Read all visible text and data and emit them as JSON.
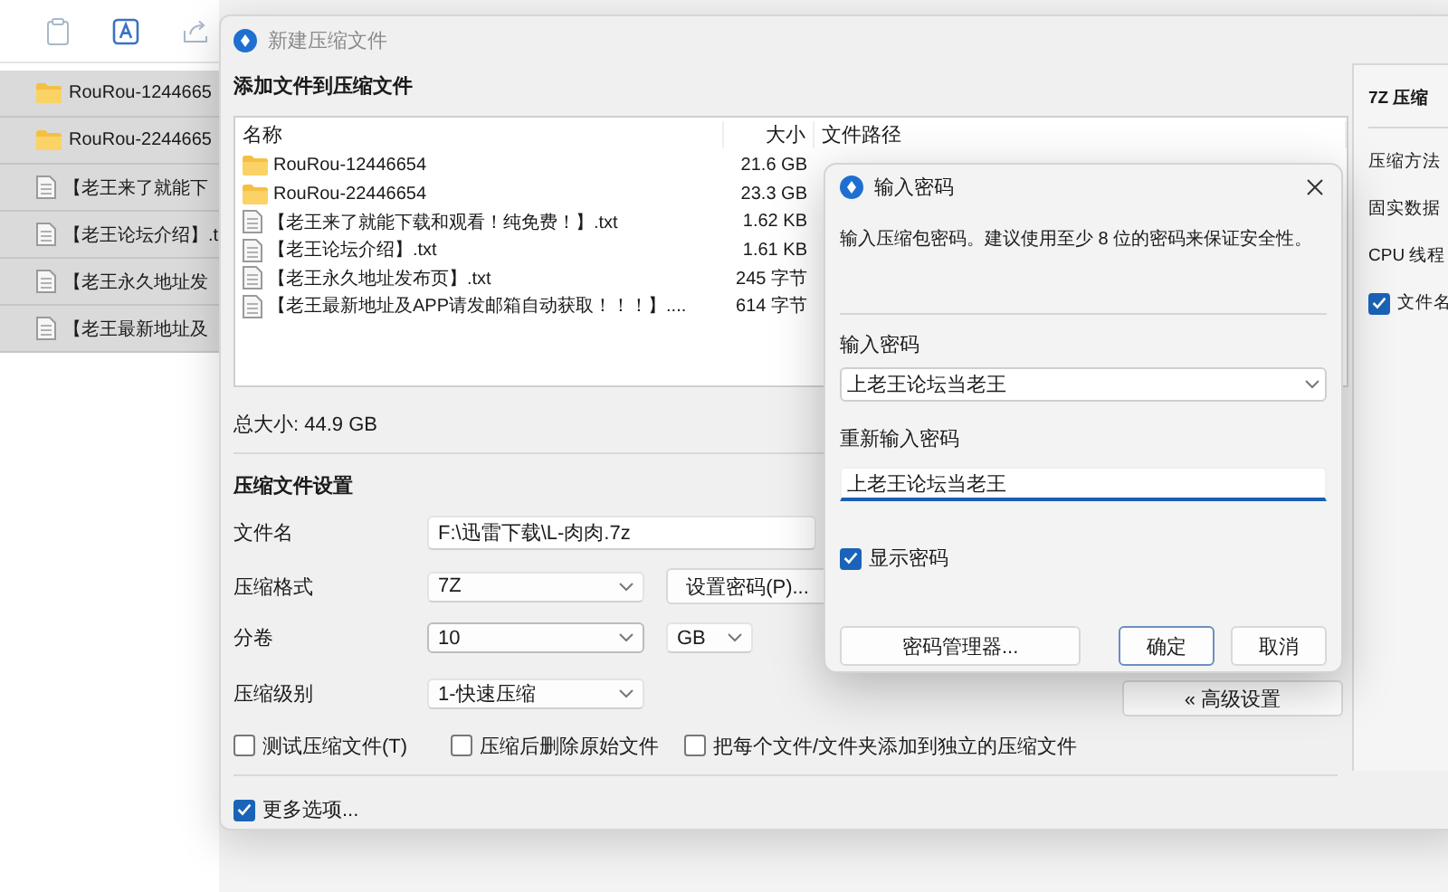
{
  "explorer": {
    "rows": [
      {
        "kind": "folder",
        "name": "RouRou-1244665"
      },
      {
        "kind": "folder",
        "name": "RouRou-2244665"
      },
      {
        "kind": "file",
        "name": "【老王来了就能下"
      },
      {
        "kind": "file",
        "name": "【老王论坛介绍】.t"
      },
      {
        "kind": "file",
        "name": "【老王永久地址发"
      },
      {
        "kind": "file",
        "name": "【老王最新地址及"
      }
    ]
  },
  "archive_dialog": {
    "title": "新建压缩文件",
    "heading": "添加文件到压缩文件",
    "table": {
      "columns": [
        "名称",
        "大小",
        "文件路径"
      ],
      "rows": [
        {
          "kind": "folder",
          "name": "RouRou-12446654",
          "size": "21.6 GB"
        },
        {
          "kind": "folder",
          "name": "RouRou-22446654",
          "size": "23.3 GB"
        },
        {
          "kind": "file",
          "name": "【老王来了就能下载和观看！纯免费！】.txt",
          "size": "1.62 KB"
        },
        {
          "kind": "file",
          "name": "【老王论坛介绍】.txt",
          "size": "1.61 KB"
        },
        {
          "kind": "file",
          "name": "【老王永久地址发布页】.txt",
          "size": "245 字节"
        },
        {
          "kind": "file",
          "name": "【老王最新地址及APP请发邮箱自动获取！！！】....",
          "size": "614 字节"
        }
      ]
    },
    "total": "总大小: 44.9 GB",
    "settings_heading": "压缩文件设置",
    "filename": {
      "label": "文件名",
      "value": "F:\\迅雷下载\\L-肉肉.7z"
    },
    "format": {
      "label": "压缩格式",
      "value": "7Z"
    },
    "set_password_button": "设置密码(P)...",
    "split": {
      "label": "分卷",
      "value": "10",
      "unit": "GB"
    },
    "level": {
      "label": "压缩级别",
      "value": "1-快速压缩"
    },
    "advanced_button": "« 高级设置",
    "options": [
      {
        "label": "测试压缩文件(T)",
        "checked": false
      },
      {
        "label": "压缩后删除原始文件",
        "checked": false
      },
      {
        "label": "把每个文件/文件夹添加到独立的压缩文件",
        "checked": false
      }
    ],
    "more_options": {
      "label": "更多选项...",
      "checked": true
    },
    "side_panel": {
      "title": "7Z 压缩",
      "items": [
        "压缩方法",
        "固实数据",
        "CPU 线程"
      ],
      "checkbox": {
        "label": "文件名",
        "checked": true
      }
    }
  },
  "password_dialog": {
    "title": "输入密码",
    "message": "输入压缩包密码。建议使用至少 8 位的密码来保证安全性。",
    "password": {
      "label": "输入密码",
      "value": "上老王论坛当老王"
    },
    "confirm": {
      "label": "重新输入密码",
      "value": "上老王论坛当老王"
    },
    "show_password": {
      "label": "显示密码",
      "checked": true
    },
    "buttons": [
      {
        "label": "密码管理器...",
        "default": false
      },
      {
        "label": "确定",
        "default": true
      },
      {
        "label": "取消",
        "default": false
      }
    ]
  }
}
